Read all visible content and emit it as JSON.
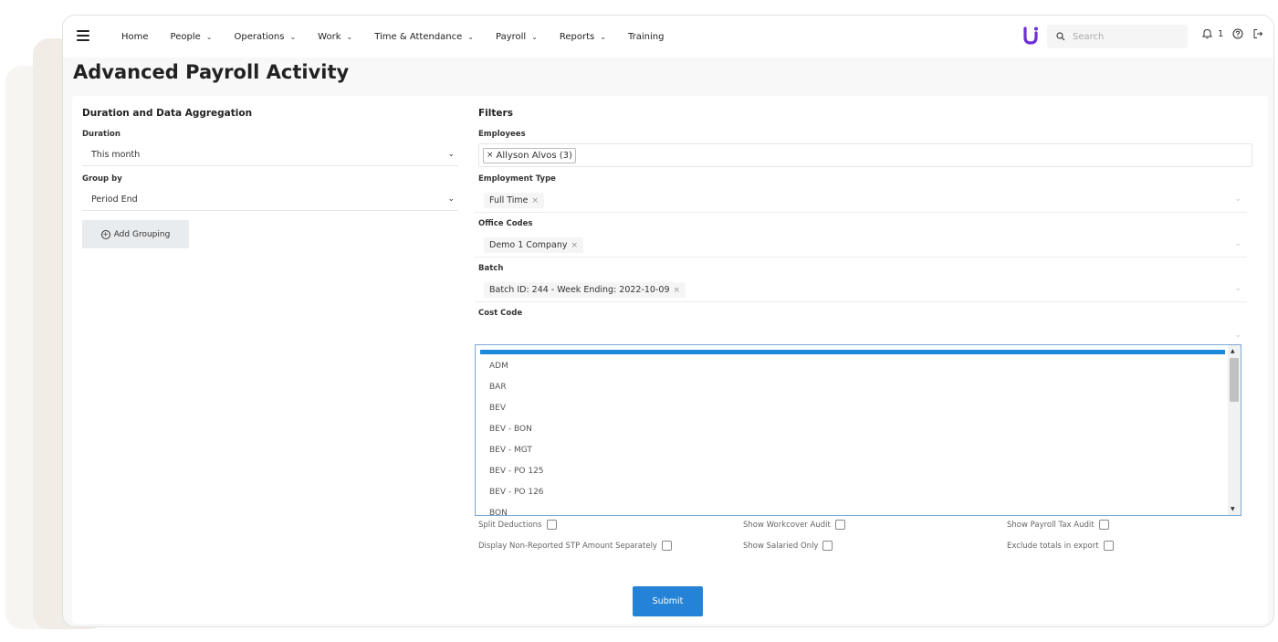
{
  "colors": {
    "accent": "#2483d7",
    "logo": "#6d2fd6",
    "highlight": "#1b88dc"
  },
  "nav": {
    "menu_icon": "hamburger-icon",
    "items": [
      {
        "label": "Home",
        "dropdown": false
      },
      {
        "label": "People",
        "dropdown": true
      },
      {
        "label": "Operations",
        "dropdown": true
      },
      {
        "label": "Work",
        "dropdown": true
      },
      {
        "label": "Time & Attendance",
        "dropdown": true
      },
      {
        "label": "Payroll",
        "dropdown": true
      },
      {
        "label": "Reports",
        "dropdown": true
      },
      {
        "label": "Training",
        "dropdown": false
      }
    ],
    "search_placeholder": "Search",
    "notification_count": "1",
    "icons": [
      "bell-icon",
      "help-icon",
      "logout-icon"
    ]
  },
  "page": {
    "title": "Advanced Payroll Activity"
  },
  "duration_section": {
    "title": "Duration and Data Aggregation",
    "duration_label": "Duration",
    "duration_value": "This month",
    "group_by_label": "Group by",
    "group_by_value": "Period End",
    "add_grouping_label": "Add Grouping"
  },
  "filters": {
    "title": "Filters",
    "employees_label": "Employees",
    "employees_tag": "Allyson Alvos (3)",
    "employment_type_label": "Employment Type",
    "employment_type_chip": "Full Time",
    "office_codes_label": "Office Codes",
    "office_codes_chip": "Demo 1 Company",
    "batch_label": "Batch",
    "batch_chip": "Batch ID: 244 - Week Ending: 2022-10-09",
    "cost_code_label": "Cost Code"
  },
  "cost_code_options": [
    "ADM",
    "BAR",
    "BEV",
    "BEV - BON",
    "BEV - MGT",
    "BEV - PO 125",
    "BEV - PO 126",
    "BON"
  ],
  "options": {
    "split_deductions": "Split Deductions",
    "show_workcover_audit": "Show Workcover Audit",
    "show_payroll_tax_audit": "Show Payroll Tax Audit",
    "display_non_reported": "Display Non-Reported STP Amount Separately",
    "show_salaried_only": "Show Salaried Only",
    "exclude_totals": "Exclude totals in export"
  },
  "submit_label": "Submit"
}
